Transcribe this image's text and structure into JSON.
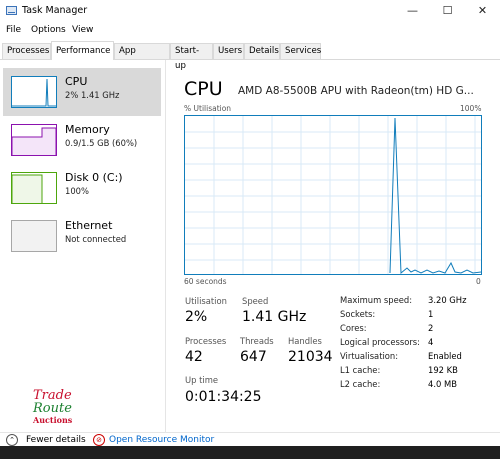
{
  "window": {
    "title": "Task Manager",
    "minimize": "—",
    "maximize": "☐",
    "close": "✕"
  },
  "menu": [
    "File",
    "Options",
    "View"
  ],
  "tabs": [
    "Processes",
    "Performance",
    "App history",
    "Start-up",
    "Users",
    "Details",
    "Services"
  ],
  "sidebar": [
    {
      "title": "CPU",
      "sub": "2% 1.41 GHz",
      "color": "#117dbb"
    },
    {
      "title": "Memory",
      "sub": "0.9/1.5 GB (60%)",
      "color": "#8b12ae"
    },
    {
      "title": "Disk 0 (C:)",
      "sub": "100%",
      "color": "#4da60c"
    },
    {
      "title": "Ethernet",
      "sub": "Not connected",
      "color": "#a7a7a7"
    }
  ],
  "main": {
    "heading": "CPU",
    "model": "AMD A8-5500B APU with Radeon(tm) HD G...",
    "graph_top_left": "% Utilisation",
    "graph_top_right": "100%",
    "graph_bottom_left": "60 seconds",
    "graph_bottom_right": "0",
    "stats": {
      "utilisation_label": "Utilisation",
      "utilisation": "2%",
      "speed_label": "Speed",
      "speed": "1.41 GHz",
      "processes_label": "Processes",
      "processes": "42",
      "threads_label": "Threads",
      "threads": "647",
      "handles_label": "Handles",
      "handles": "21034",
      "uptime_label": "Up time",
      "uptime": "0:01:34:25"
    },
    "specs": [
      [
        "Maximum speed:",
        "3.20 GHz"
      ],
      [
        "Sockets:",
        "1"
      ],
      [
        "Cores:",
        "2"
      ],
      [
        "Logical processors:",
        "4"
      ],
      [
        "Virtualisation:",
        "Enabled"
      ],
      [
        "L1 cache:",
        "192 KB"
      ],
      [
        "L2 cache:",
        "4.0 MB"
      ]
    ]
  },
  "footer": {
    "fewer_details": "Fewer details",
    "open_monitor": "Open Resource Monitor"
  },
  "watermark": {
    "line1": "Trade",
    "line2": "Route",
    "line3": "Auctions"
  },
  "colors": {
    "accent": "#117dbb",
    "link": "#0066cc"
  }
}
